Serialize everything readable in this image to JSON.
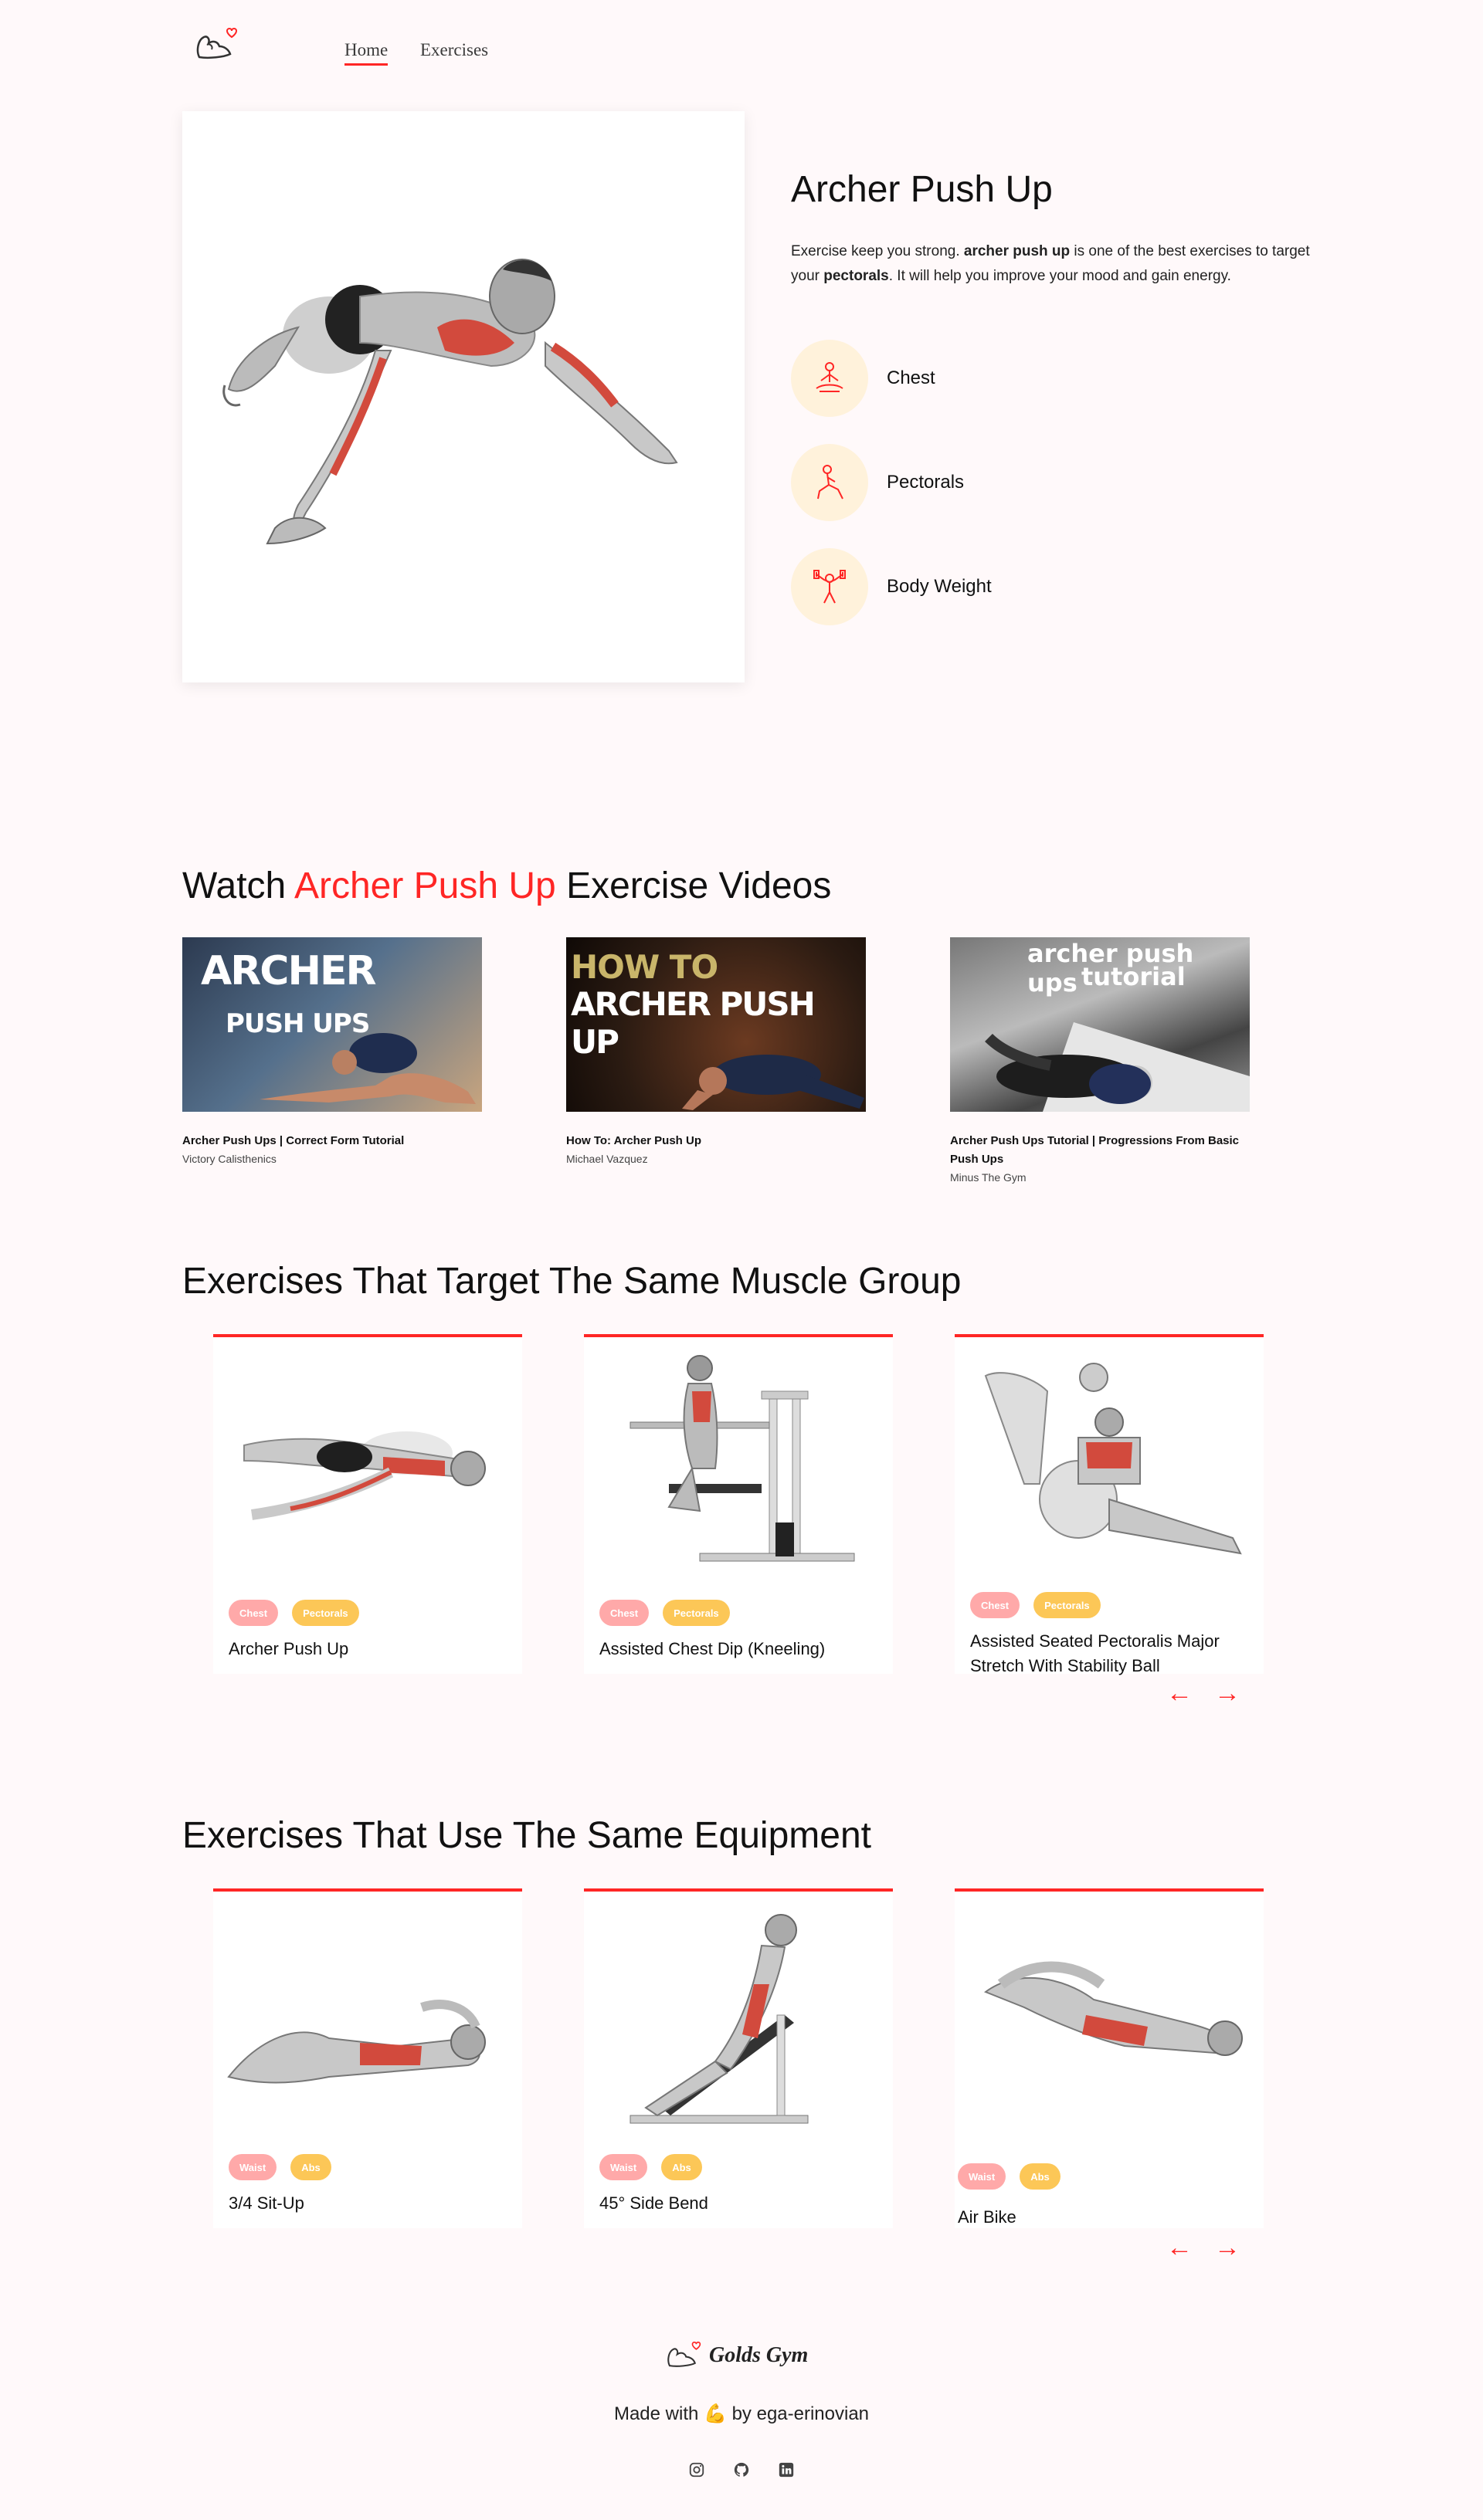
{
  "nav": {
    "home_label": "Home",
    "exercises_label": "Exercises"
  },
  "detail": {
    "title": "Archer Push Up",
    "desc_prefix": "Exercise keep you strong. ",
    "desc_name": "archer push up",
    "desc_mid": " is one of the best exercises to target your ",
    "desc_target": "pectorals",
    "desc_suffix": ". It will help you improve your mood and gain energy.",
    "attributes": [
      {
        "icon": "meditation-icon",
        "label": "Chest"
      },
      {
        "icon": "lunge-icon",
        "label": "Pectorals"
      },
      {
        "icon": "dumbbell-person-icon",
        "label": "Body Weight"
      }
    ]
  },
  "videos_section": {
    "prefix": "Watch ",
    "name": "Archer Push Up",
    "suffix": " Exercise Videos",
    "videos": [
      {
        "title": "Archer Push Ups | Correct Form Tutorial",
        "channel": "Victory Calisthenics",
        "thumb_text_1": "ARCHER",
        "thumb_text_2": "PUSH UPS"
      },
      {
        "title": "How To: Archer Push Up",
        "channel": "Michael Vazquez",
        "thumb_text_1": "HOW TO",
        "thumb_text_2": "ARCHER PUSH UP"
      },
      {
        "title": "Archer Push Ups Tutorial | Progressions From Basic Push Ups",
        "channel": "Minus The Gym",
        "thumb_text_1": "archer push ups",
        "thumb_text_2": "tutorial"
      }
    ]
  },
  "muscle_section": {
    "title": "Exercises That Target The Same Muscle Group",
    "cards": [
      {
        "name": "Archer Push Up",
        "tag1": "Chest",
        "tag2": "Pectorals"
      },
      {
        "name": "Assisted Chest Dip (Kneeling)",
        "tag1": "Chest",
        "tag2": "Pectorals"
      },
      {
        "name": "Assisted Seated Pectoralis Major Stretch With Stability Ball",
        "tag1": "Chest",
        "tag2": "Pectorals"
      }
    ]
  },
  "equipment_section": {
    "title": "Exercises That Use The Same Equipment",
    "cards": [
      {
        "name": "3/4 Sit-Up",
        "tag1": "Waist",
        "tag2": "Abs"
      },
      {
        "name": "45° Side Bend",
        "tag1": "Waist",
        "tag2": "Abs"
      },
      {
        "name": "Air Bike",
        "tag1": "Waist",
        "tag2": "Abs"
      }
    ]
  },
  "arrows": {
    "left": "←",
    "right": "→"
  },
  "footer": {
    "brand": "Golds Gym",
    "made_prefix": "Made with ",
    "made_emoji": "💪",
    "made_suffix": " by ega-erinovian",
    "socials": [
      "instagram-icon",
      "github-icon",
      "linkedin-icon"
    ]
  },
  "colors": {
    "accent": "#ff2625",
    "background": "#fff9fa",
    "tag_pink": "#ffa9a9",
    "tag_yellow": "#fcc757",
    "icon_circle": "#fff2db"
  }
}
